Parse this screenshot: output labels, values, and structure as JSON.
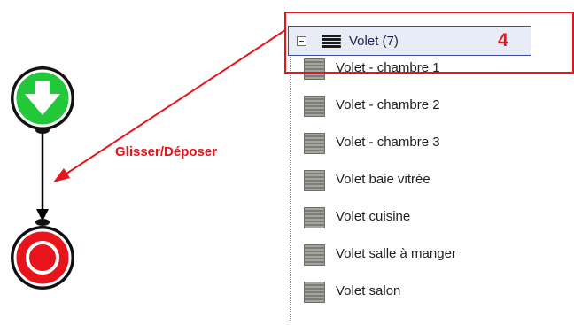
{
  "annotation": {
    "drag_label": "Glisser/Déposer",
    "step_number": "4",
    "color": "#e8141b"
  },
  "flow": {
    "start_icon": "arrow-down-icon",
    "end_icon": "stop-icon",
    "start_color": "#22c83a",
    "end_color": "#e8141b"
  },
  "tree": {
    "group": {
      "label": "Volet (7)",
      "icon": "stack-icon",
      "expander": "collapse-icon"
    },
    "items": [
      {
        "label": "Volet - chambre 1",
        "icon": "shutter-icon"
      },
      {
        "label": "Volet - chambre 2",
        "icon": "shutter-icon"
      },
      {
        "label": "Volet - chambre 3",
        "icon": "shutter-icon"
      },
      {
        "label": "Volet baie vitrée",
        "icon": "shutter-icon"
      },
      {
        "label": "Volet cuisine",
        "icon": "shutter-icon"
      },
      {
        "label": "Volet salle à manger",
        "icon": "shutter-icon"
      },
      {
        "label": "Volet salon",
        "icon": "shutter-icon"
      }
    ]
  }
}
